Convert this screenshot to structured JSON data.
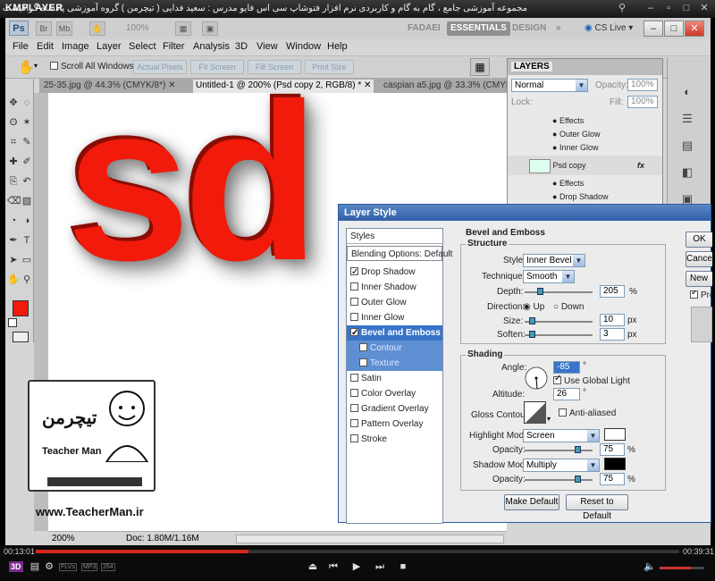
{
  "kmplayer": {
    "logo": "KMPLAYER",
    "caption": "مجموعه آموزشی جامع ، گام به گام و کاربردی نرم افزار فتوشاپ سی اس فایو   مدرس : سعید فدایی ( تیچرمن ) گروه آموزشی پادشاه گرافیست ها",
    "elapsed": "00:13:01",
    "total": "00:39:31",
    "progress_fraction": 0.33,
    "volume_fraction": 0.7,
    "badges": [
      "3D",
      "FLVs",
      "MP3",
      "264"
    ]
  },
  "ps": {
    "logo": "Ps",
    "zoom": "100%",
    "workspaces": [
      "FADAEI",
      "ESSENTIALS",
      "DESIGN"
    ],
    "more": "»",
    "cs_live": "CS Live",
    "window_controls": [
      "–",
      "□",
      "✕"
    ],
    "menu": [
      "File",
      "Edit",
      "Image",
      "Layer",
      "Select",
      "Filter",
      "Analysis",
      "3D",
      "View",
      "Window",
      "Help"
    ],
    "options": {
      "scroll_all": "Scroll All Windows",
      "buttons": [
        "Actual Pixels",
        "Fit Screen",
        "Fill Screen",
        "Print Size"
      ]
    },
    "tabs": [
      "25-35.jpg @ 44.3% (CMYK/8*)",
      "Untitled-1 @ 200% (Psd copy 2, RGB/8) *",
      "caspian a5.jpg @ 33.3% (CMYK/8*)"
    ],
    "canvas_text": "sd",
    "status": {
      "zoom": "200%",
      "doc": "Doc: 1.80M/1.16M"
    },
    "layers": {
      "title": "LAYERS",
      "mode": "Normal",
      "opacity_label": "Opacity:",
      "opacity": "100%",
      "lock_label": "Lock:",
      "fill_label": "Fill:",
      "fill": "100%",
      "rows": [
        "Effects",
        "Outer Glow",
        "Inner Glow",
        "Psd copy",
        "Effects",
        "Drop Shadow"
      ],
      "fx": "fx"
    },
    "tool_icons": [
      "move-icon",
      "marquee-icon",
      "lasso-icon",
      "magic-wand-icon",
      "crop-icon",
      "eyedropper-icon",
      "healing-icon",
      "brush-icon",
      "stamp-icon",
      "history-brush-icon",
      "eraser-icon",
      "gradient-icon",
      "blur-icon",
      "dodge-icon",
      "pen-icon",
      "type-icon",
      "path-select-icon",
      "shape-icon",
      "hand-icon",
      "zoom-icon"
    ],
    "fg_color": "#f21a0b",
    "bg_color": "#ffffff"
  },
  "watermark": {
    "site": "www.TeacherMan.ir",
    "brand": "Teacher Man",
    "persian": "تیچرمن"
  },
  "dialog": {
    "title": "Layer Style",
    "styles_header": "Styles",
    "blending": "Blending Options: Default",
    "items": [
      {
        "label": "Drop Shadow",
        "checked": true
      },
      {
        "label": "Inner Shadow",
        "checked": false
      },
      {
        "label": "Outer Glow",
        "checked": false
      },
      {
        "label": "Inner Glow",
        "checked": false
      },
      {
        "label": "Bevel and Emboss",
        "checked": true
      },
      {
        "label": "Contour",
        "checked": false
      },
      {
        "label": "Texture",
        "checked": false
      },
      {
        "label": "Satin",
        "checked": false
      },
      {
        "label": "Color Overlay",
        "checked": false
      },
      {
        "label": "Gradient Overlay",
        "checked": false
      },
      {
        "label": "Pattern Overlay",
        "checked": false
      },
      {
        "label": "Stroke",
        "checked": false
      }
    ],
    "section_title": "Bevel and Emboss",
    "structure": {
      "title": "Structure",
      "style_label": "Style:",
      "style": "Inner Bevel",
      "technique_label": "Technique:",
      "technique": "Smooth",
      "depth_label": "Depth:",
      "depth": "205",
      "depth_unit": "%",
      "direction_label": "Direction:",
      "up": "Up",
      "down": "Down",
      "size_label": "Size:",
      "size": "10",
      "size_unit": "px",
      "soften_label": "Soften:",
      "soften": "3",
      "soften_unit": "px"
    },
    "shading": {
      "title": "Shading",
      "angle_label": "Angle:",
      "angle": "-85",
      "deg": "°",
      "global_light": "Use Global Light",
      "altitude_label": "Altitude:",
      "altitude": "26",
      "gloss_label": "Gloss Contour:",
      "anti_aliased": "Anti-aliased",
      "highlight_label": "Highlight Mode:",
      "highlight": "Screen",
      "highlight_opacity_label": "Opacity:",
      "highlight_opacity": "75",
      "pct": "%",
      "shadow_label": "Shadow Mode:",
      "shadow": "Multiply",
      "shadow_opacity_label": "Opacity:",
      "shadow_opacity": "75",
      "highlight_color": "#ffffff",
      "shadow_color": "#000000"
    },
    "make_default": "Make Default",
    "reset_default": "Reset to Default",
    "right_buttons": [
      "OK",
      "Cancel",
      "New Style...",
      "Preview"
    ]
  }
}
